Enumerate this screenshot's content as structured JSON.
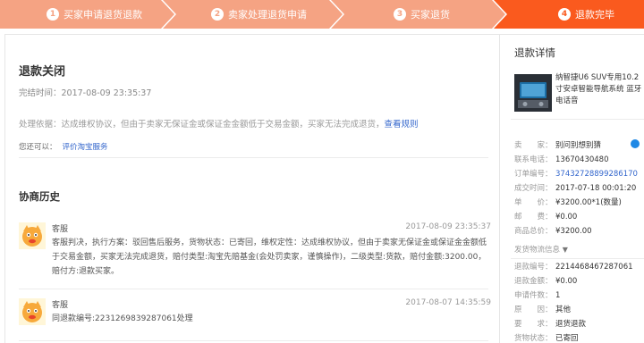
{
  "steps": [
    {
      "num": "1",
      "label": "买家申请退货退款"
    },
    {
      "num": "2",
      "label": "卖家处理退货申请"
    },
    {
      "num": "3",
      "label": "买家退货"
    },
    {
      "num": "4",
      "label": "退款完毕"
    }
  ],
  "colors": {
    "step_inactive": "#f5a383",
    "step_active": "#fa5a1e",
    "link": "#3366cc"
  },
  "refund": {
    "status_title": "退款关闭",
    "finish_time": "完结时间：2017-08-09 23:35:37",
    "basis_text": "处理依据：达成维权协议，但由于卖家无保证金或保证金金额低于交易金额，买家无法完成退货，",
    "basis_link": "查看规则",
    "also_label": "您还可以：",
    "also_link": "评价淘宝服务"
  },
  "history": {
    "title": "协商历史",
    "messages": [
      {
        "who": "客服",
        "time": "2017-08-09 23:35:37",
        "body": "客服判决，执行方案：驳回售后服务，货物状态：已寄回，维权定性：达成维权协议，但由于卖家无保证金或保证金金额低于交易金额，买家无法完成退货，赔付类型:淘宝先赔基金(会处罚卖家，谨慎操作)，二级类型:货款，赔付金额:3200.00，赔付方:退款买家。",
        "avatar": "customer-service-avatar"
      },
      {
        "who": "客服",
        "time": "2017-08-07 14:35:59",
        "body": "同退款编号:2231269839287061处理",
        "avatar": "customer-service-avatar"
      }
    ]
  },
  "detail": {
    "title": "退款详情",
    "product_name": "纳智捷U6 SUV专用10.2寸安卓智能导航系统 蓝牙电话音",
    "seller_rows": [
      {
        "k": "卖　　家：",
        "v": "别问别想别猜",
        "link": false
      },
      {
        "k": "联系电话：",
        "v": "13670430480",
        "link": false
      },
      {
        "k": "订单编号：",
        "v": "37432728899286170",
        "link": true
      },
      {
        "k": "成交时间：",
        "v": "2017-07-18 00:01:20",
        "link": false
      },
      {
        "k": "单　　价：",
        "v": "¥3200.00*1(数量)",
        "link": false
      },
      {
        "k": "邮　　费：",
        "v": "¥0.00",
        "link": false
      },
      {
        "k": "商品总价：",
        "v": "¥3200.00",
        "link": false
      }
    ],
    "logistics_label": "发货物流信息",
    "refund_rows": [
      {
        "k": "退款编号：",
        "v": "2214468467287061"
      },
      {
        "k": "退款金额：",
        "v": "¥0.00"
      },
      {
        "k": "申请件数：",
        "v": "1"
      },
      {
        "k": "原　　因：",
        "v": "其他"
      },
      {
        "k": "要　　求：",
        "v": "退货退款"
      },
      {
        "k": "货物状态：",
        "v": "已寄回"
      }
    ]
  }
}
